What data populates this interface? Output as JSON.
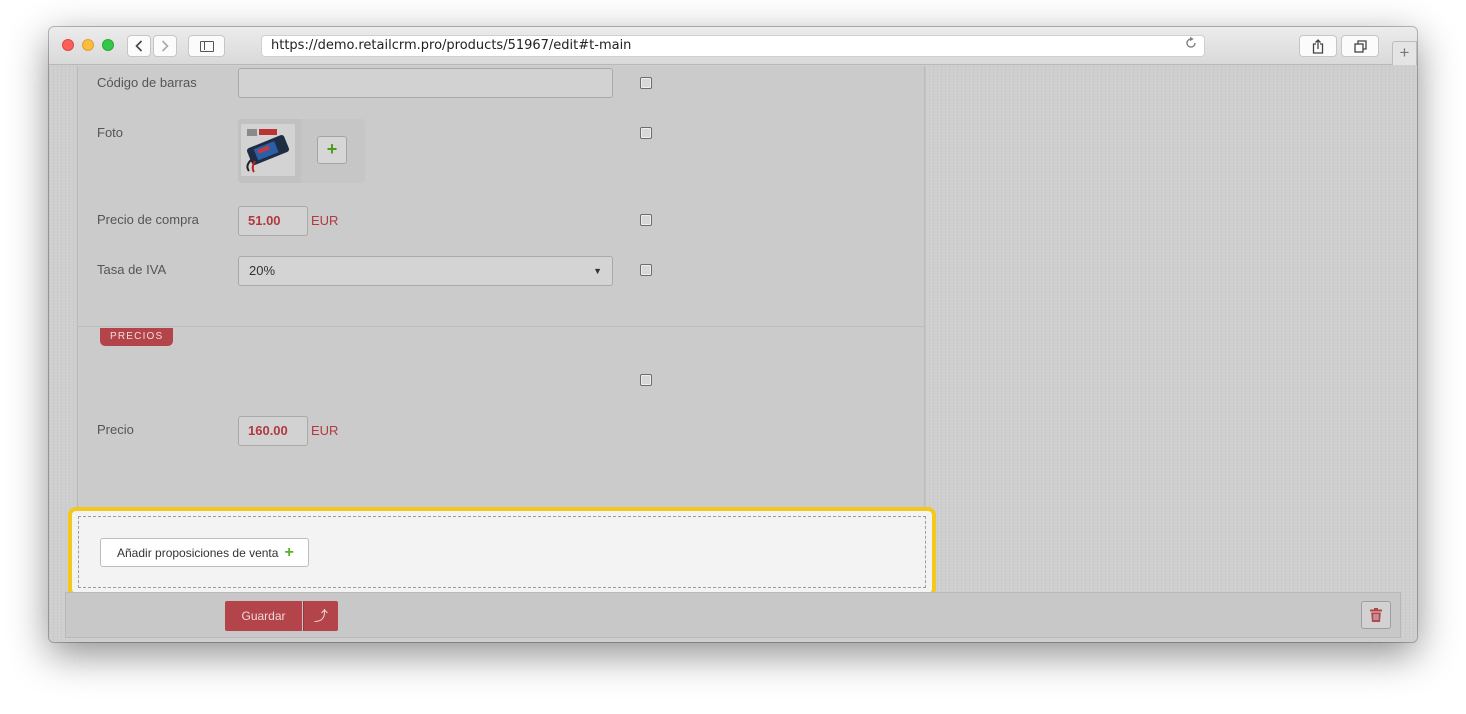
{
  "browser": {
    "url": "https://demo.retailcrm.pro/products/51967/edit#t-main"
  },
  "form": {
    "barcode_label": "Código de barras",
    "barcode_value": "",
    "photo_label": "Foto",
    "photo_add_label": "+",
    "purchase_price_label": "Precio de compra",
    "purchase_price_value": "51.00",
    "purchase_price_currency": "EUR",
    "vat_label": "Tasa de IVA",
    "vat_value": "20%"
  },
  "prices": {
    "section_tag": "PRECIOS",
    "price_label": "Precio",
    "price_value": "160.00",
    "price_currency": "EUR"
  },
  "offers": {
    "add_button_label": "Añadir proposiciones de venta",
    "add_button_icon": "+"
  },
  "footer": {
    "save_label": "Guardar",
    "save_up_glyph": "⤴"
  },
  "colors": {
    "accent_red": "#b2444a",
    "highlight_yellow": "#f2c81c",
    "plus_green": "#58b024"
  },
  "icons": [
    "chevron-left-icon",
    "chevron-right-icon",
    "sidebar-icon",
    "reload-icon",
    "share-icon",
    "tabs-icon",
    "plus-icon",
    "battery-photo",
    "caret-down-icon",
    "trash-icon"
  ]
}
